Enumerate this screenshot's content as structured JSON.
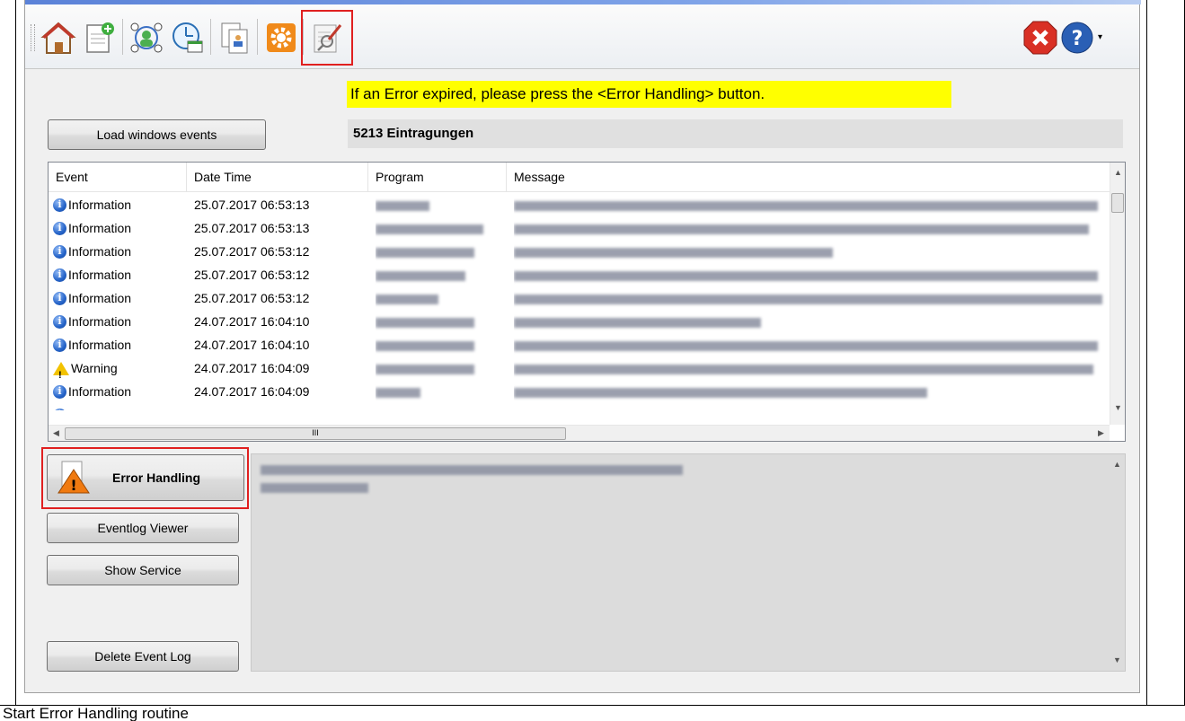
{
  "toolbar": {
    "buttons": [
      {
        "icon": "home-icon"
      },
      {
        "icon": "new-document-icon"
      },
      {
        "icon": "network-users-icon"
      },
      {
        "icon": "scheduler-clock-icon"
      },
      {
        "icon": "copy-documents-icon"
      },
      {
        "icon": "settings-gear-icon"
      },
      {
        "icon": "edit-search-icon",
        "highlighted": true
      }
    ],
    "right": [
      {
        "icon": "close-error-icon"
      },
      {
        "icon": "help-icon"
      }
    ]
  },
  "banner": {
    "text": "If an Error expired, please press the <Error Handling> button."
  },
  "load_button": {
    "label": "Load windows events"
  },
  "entry_count": {
    "text": "5213 Eintragungen"
  },
  "table": {
    "columns": [
      "Event",
      "Date Time",
      "Program",
      "Message"
    ],
    "rows": [
      {
        "type": "info",
        "event": "Information",
        "datetime": "25.07.2017 06:53:13"
      },
      {
        "type": "info",
        "event": "Information",
        "datetime": "25.07.2017 06:53:13"
      },
      {
        "type": "info",
        "event": "Information",
        "datetime": "25.07.2017 06:53:12"
      },
      {
        "type": "info",
        "event": "Information",
        "datetime": "25.07.2017 06:53:12"
      },
      {
        "type": "info",
        "event": "Information",
        "datetime": "25.07.2017 06:53:12"
      },
      {
        "type": "info",
        "event": "Information",
        "datetime": "24.07.2017 16:04:10"
      },
      {
        "type": "info",
        "event": "Information",
        "datetime": "24.07.2017 16:04:10"
      },
      {
        "type": "warning",
        "event": "Warning",
        "datetime": "24.07.2017 16:04:09"
      },
      {
        "type": "info",
        "event": "Information",
        "datetime": "24.07.2017 16:04:09"
      }
    ],
    "hscroll_thumb_label": "III"
  },
  "side_buttons": {
    "error_handling": "Error Handling",
    "eventlog_viewer": "Eventlog Viewer",
    "show_service": "Show Service",
    "delete_event_log": "Delete Event Log"
  },
  "caption": {
    "text": "Start Error Handling routine"
  },
  "colors": {
    "highlight": "#e02020",
    "banner": "#ffff00"
  }
}
